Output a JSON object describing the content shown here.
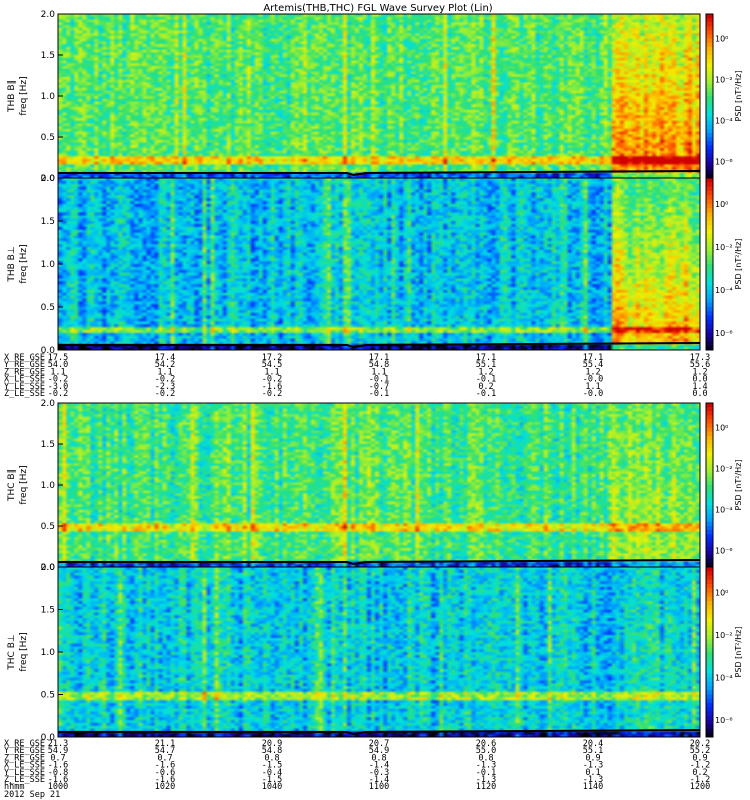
{
  "chart_data": {
    "type": "heatmap",
    "title": "Artemis(THB,THC) FGL Wave Survey Plot (Lin)",
    "date_label": "2012 Sep 21",
    "panels": [
      {
        "id": "thb_bpar",
        "probe": "THB",
        "ylabel_top": "THB B∥",
        "ylabel": "freq [Hz]",
        "ylim": [
          0,
          2.0
        ],
        "yticks": [
          "0.0",
          "0.5",
          "1.0",
          "1.5",
          "2.0"
        ],
        "colorbar_label": "PSD [nT²/Hz]",
        "cb_ticks": [
          "10⁰",
          "10⁻²",
          "10⁻⁴",
          "10⁻⁶"
        ],
        "line_hz": 0.22,
        "bg": 0.52,
        "late_boost": 0.34
      },
      {
        "id": "thb_bperp",
        "probe": "THB",
        "ylabel_top": "THB B⊥",
        "ylabel": "freq [Hz]",
        "ylim": [
          0,
          2.0
        ],
        "yticks": [
          "0.0",
          "0.5",
          "1.0",
          "1.5",
          "2.0"
        ],
        "colorbar_label": "PSD [nT²/Hz]",
        "cb_ticks": [
          "10⁰",
          "10⁻²",
          "10⁻⁴",
          "10⁻⁶"
        ],
        "line_hz": 0.24,
        "bg": 0.36,
        "late_boost": 0.42
      },
      {
        "id": "thc_bpar",
        "probe": "THC",
        "ylabel_top": "THC B∥",
        "ylabel": "freq [Hz]",
        "ylim": [
          0,
          2.0
        ],
        "yticks": [
          "0.0",
          "0.5",
          "1.0",
          "1.5",
          "2.0"
        ],
        "colorbar_label": "PSD [nT²/Hz]",
        "cb_ticks": [
          "10⁰",
          "10⁻²",
          "10⁻⁴",
          "10⁻⁶"
        ],
        "line_hz": 0.48,
        "bg": 0.5,
        "late_boost": 0.12
      },
      {
        "id": "thc_bperp",
        "probe": "THC",
        "ylabel_top": "THC B⊥",
        "ylabel": "freq [Hz]",
        "ylim": [
          0,
          2.0
        ],
        "yticks": [
          "0.0",
          "0.5",
          "1.0",
          "1.5",
          "2.0"
        ],
        "colorbar_label": "PSD [nT²/Hz]",
        "cb_ticks": [
          "10⁰",
          "10⁻²",
          "10⁻⁴",
          "10⁻⁶"
        ],
        "line_hz": 0.48,
        "bg": 0.38,
        "late_boost": 0.05
      }
    ],
    "thb_ephemeris": [
      {
        "label": "X_RE_GSE",
        "values": [
          "17.5",
          "17.4",
          "17.2",
          "17.1",
          "17.1",
          "17.1",
          "17.3"
        ]
      },
      {
        "label": "Y_RE_GSE",
        "values": [
          "54.0",
          "54.2",
          "54.5",
          "54.8",
          "55.1",
          "55.4",
          "55.6"
        ]
      },
      {
        "label": "Z_RE_GSE",
        "values": [
          "1.1",
          "1.1",
          "1.1",
          "1.1",
          "1.2",
          "1.2",
          "1.2"
        ]
      },
      {
        "label": "X_LE_SSE",
        "values": [
          "-0.2",
          "-0.2",
          "-0.2",
          "-0.1",
          "-0.1",
          "-0.0",
          "0.0"
        ]
      },
      {
        "label": "Y_LE_SSE",
        "values": [
          "-3.0",
          "-2.3",
          "-1.6",
          "-0.7",
          "0.2",
          "1.1",
          "1.4"
        ]
      },
      {
        "label": "Z_LE_SSE",
        "values": [
          "-0.2",
          "-0.2",
          "-0.2",
          "-0.1",
          "-0.1",
          "-0.0",
          "0.0"
        ]
      }
    ],
    "thc_ephemeris": [
      {
        "label": "X_RE_GSE",
        "values": [
          "21.3",
          "21.1",
          "20.9",
          "20.7",
          "20.6",
          "20.4",
          "20.2"
        ]
      },
      {
        "label": "Y_RE_GSE",
        "values": [
          "54.9",
          "54.7",
          "54.8",
          "54.9",
          "55.0",
          "55.1",
          "55.2"
        ]
      },
      {
        "label": "Z_RE_GSE",
        "values": [
          "0.7",
          "0.7",
          "0.8",
          "0.8",
          "0.8",
          "0.9",
          "0.9"
        ]
      },
      {
        "label": "X_LE_SSE",
        "values": [
          "-1.6",
          "-1.6",
          "-1.5",
          "-1.4",
          "-1.3",
          "-1.3",
          "-1.2"
        ]
      },
      {
        "label": "Y_LE_SSE",
        "values": [
          "-0.8",
          "-0.6",
          "-0.4",
          "-0.3",
          "-0.1",
          "0.1",
          "0.2"
        ]
      },
      {
        "label": "Z_LE_SSE",
        "values": [
          "-1.6",
          "-1.6",
          "-1.5",
          "-1.4",
          "-1.3",
          "-1.3",
          "-1.2"
        ]
      },
      {
        "label": "hhmm",
        "values": [
          "1000",
          "1020",
          "1040",
          "1100",
          "1120",
          "1140",
          "1200"
        ]
      }
    ],
    "colorscale": [
      "#000000",
      "#1a00a0",
      "#0030ff",
      "#00a0ff",
      "#00e0e0",
      "#30e070",
      "#a0f030",
      "#f0f000",
      "#ffb000",
      "#ff5000",
      "#d00000"
    ]
  }
}
